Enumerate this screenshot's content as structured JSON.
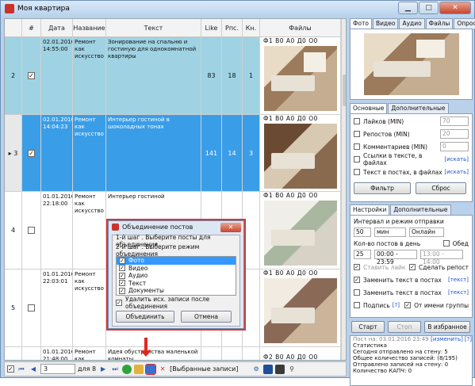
{
  "window": {
    "title": "Моя квартира"
  },
  "grid": {
    "headers": [
      "#",
      "Дата",
      "Название",
      "Текст",
      "Like",
      "Рпс.",
      "Кн.",
      "Файлы"
    ],
    "rows": [
      {
        "num": "2",
        "checked": "✓",
        "date": "02.01.2016 14:55:00",
        "name": "Ремонт как искусство",
        "text": "Зонирование на спальню и гостиную для однокомнатной квартиры",
        "like": "83",
        "rps": "18",
        "kn": "1",
        "files": "Ф1 В0 А0 Д0 О0"
      },
      {
        "num": "▸ 3",
        "checked": "✓",
        "date": "02.01.2016 14:04:23",
        "name": "Ремонт как искусство",
        "text": "Интерьер гостиной в шоколадных тонах",
        "like": "141",
        "rps": "14",
        "kn": "3",
        "files": "Ф1 В0 А0 Д0 О0"
      },
      {
        "num": "4",
        "checked": "",
        "date": "01.01.2016 22:18:00",
        "name": "Ремонт как искусство",
        "text": "Интерьер гостиной",
        "like": "",
        "rps": "",
        "kn": "",
        "files": "Ф1 В0 А0 Д0 О0"
      },
      {
        "num": "5",
        "checked": "",
        "date": "01.01.2016 22:03:01",
        "name": "Ремонт как искусство",
        "text": "",
        "like": "",
        "rps": "",
        "kn": "",
        "files": "Ф1 В0 А0 Д0 О0"
      },
      {
        "num": "",
        "checked": "",
        "date": "01.01.2016 21:48:00",
        "name": "Ремонт как",
        "text": "Идея обустройства маленькой комнаты",
        "like": "",
        "rps": "",
        "kn": "",
        "files": "Ф2 В0 А0 Д0 О0"
      }
    ]
  },
  "nav": {
    "page": "3",
    "total": "для 8",
    "filter": "[Выбранные записи]"
  },
  "right": {
    "media_tabs": [
      "Фото",
      "Видео",
      "Аудио",
      "Файлы",
      "Опрос"
    ],
    "filter_tabs": [
      "Основные",
      "Дополнительные"
    ],
    "filters": [
      {
        "label": "Лайков (MIN)",
        "value": "70"
      },
      {
        "label": "Репостов (MIN)",
        "value": "20"
      },
      {
        "label": "Комментариев (MIN)",
        "value": "0"
      }
    ],
    "links_label": "Ссылки в тексте, в файлах",
    "text_label": "Текст в постах, в файлах",
    "search_link": "[искать]",
    "filter_btn": "Фильтр",
    "reset_btn": "Сброс",
    "settings_tabs": [
      "Настройки",
      "Дополнительные"
    ],
    "interval_label": "Интервал и режим отправки",
    "interval_value": "50",
    "interval_unit": "мин",
    "mode": "Онлайн",
    "count_label": "Кол-во постов в день",
    "lunch_label": "Обед",
    "count_value": "25",
    "time_range": "00:00 - 23:59",
    "lunch_range": "13:00 - 14:00",
    "like_label": "Ставить лайк",
    "repost_label": "Сделать репост",
    "replace_text_label": "Заменить текст в постах",
    "replace_posts_label": "Заменить текст в постах",
    "text_link": "[текст]",
    "sign_label": "Подпись",
    "sign_hint": "[?]",
    "group_label": "От имени группы",
    "start_btn": "Старт",
    "stop_btn": "Стоп",
    "fav_btn": "В избранное",
    "status_post": "Пост на: 03.01.2016 23:49",
    "status_change": "[изменить]",
    "status_hint": "[?]",
    "stats": [
      "Статистика",
      "Сегодня отправлено на стену: 5",
      "Общее количество записей: (8/195)",
      "Отправлено записей на стену: 0",
      "Количество КАПЧ: 0"
    ]
  },
  "dialog": {
    "title": "Объединение постов",
    "step1": "1-й шаг . Выберите посты для объединения",
    "step2": "2-й шаг . Выберите режим объединения",
    "options": [
      "Фото",
      "Видео",
      "Аудио",
      "Текст",
      "Документы"
    ],
    "delete_label": "Удалить исх. записи после объединения",
    "ok": "Объединить",
    "cancel": "Отмена"
  }
}
